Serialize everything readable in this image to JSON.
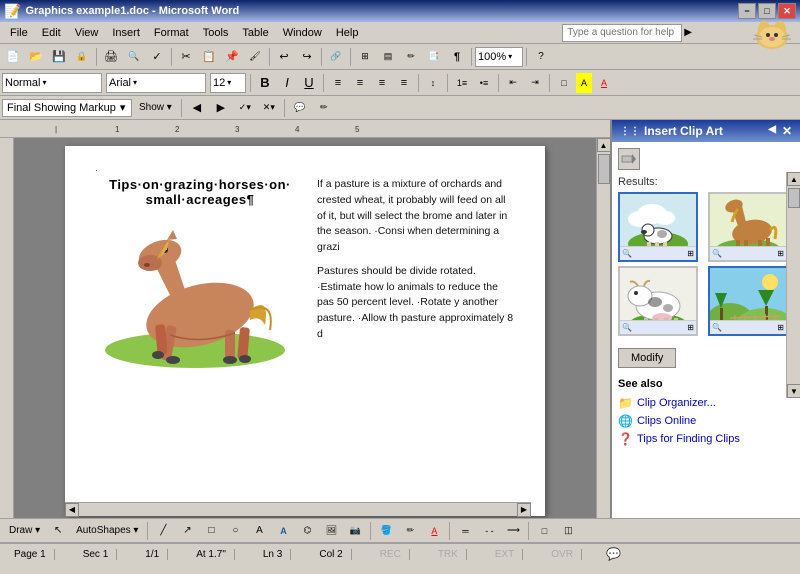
{
  "window": {
    "title": "Graphics example1.doc - Microsoft Word",
    "min_label": "−",
    "max_label": "□",
    "close_label": "✕"
  },
  "menubar": {
    "items": [
      "File",
      "Edit",
      "View",
      "Insert",
      "Format",
      "Tools",
      "Table",
      "Window",
      "Help"
    ]
  },
  "toolbar": {
    "style_value": "Normal",
    "font_value": "Arial",
    "size_value": "12",
    "bold": "B",
    "italic": "I",
    "underline": "U",
    "zoom_value": "100%"
  },
  "review_toolbar": {
    "markup_label": "Final Showing Markup",
    "show_label": "Show ▾"
  },
  "document": {
    "title": "Tips·on·grazing·horses·on·\nsmall·acreages¶",
    "para1": "If a pasture is a mixture of orchards and crested wheat, it probably will feed on all of it, but will select the brome and later in the season. Consi when determining a grazi",
    "para2": "Pastures should be divide rotated. Estimate how lo animals to reduce the pas 50 percent level. Rotate y another pasture. Allow th pasture approximately 8 d"
  },
  "clip_art_panel": {
    "title": "Insert Clip Art",
    "close_label": "✕",
    "results_label": "Results:",
    "modify_label": "Modify",
    "see_also_label": "See also",
    "items": [
      {
        "id": 1,
        "label": "cow on green"
      },
      {
        "id": 2,
        "label": "horse grazing"
      },
      {
        "id": 3,
        "label": "cow close up"
      },
      {
        "id": 4,
        "label": "landscape"
      }
    ],
    "see_also_items": [
      {
        "label": "Clip Organizer...",
        "icon": "📁"
      },
      {
        "label": "Clips Online",
        "icon": "🌐"
      },
      {
        "label": "Tips for Finding Clips",
        "icon": "❓"
      }
    ]
  },
  "draw_toolbar": {
    "draw_label": "Draw ▾",
    "autoshapes_label": "AutoShapes ▾"
  },
  "statusbar": {
    "page": "Page 1",
    "sec": "Sec 1",
    "page_of": "1/1",
    "at": "At 1.7\"",
    "ln": "Ln 3",
    "col": "Col 2",
    "rec": "REC",
    "trk": "TRK",
    "ext": "EXT",
    "ovr": "OVR"
  },
  "help_placeholder": "Type a question for help"
}
